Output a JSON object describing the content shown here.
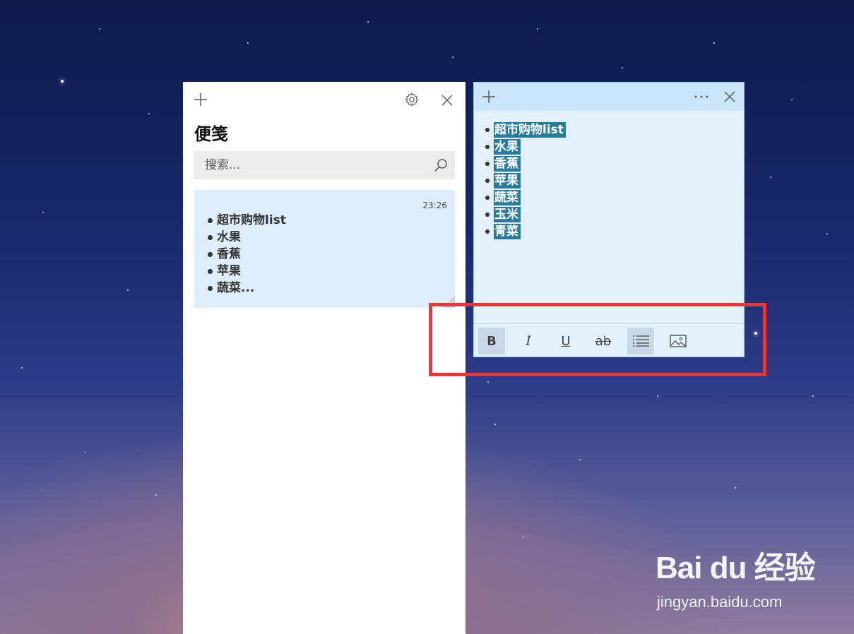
{
  "list_panel": {
    "title": "便笺",
    "search_placeholder": "搜索...",
    "note_card": {
      "time": "23:26",
      "items": [
        "超市购物list",
        "水果",
        "香蕉",
        "苹果",
        "蔬菜..."
      ]
    }
  },
  "note_window": {
    "items": [
      "超市购物list",
      "水果",
      "香蕉",
      "苹果",
      "蔬菜",
      "玉米",
      "青菜"
    ],
    "toolbar": {
      "bold": "B",
      "italic": "I",
      "underline": "U",
      "strikethrough": "ab"
    }
  },
  "watermark": {
    "logo": "Bai du 经验",
    "url": "jingyan.baidu.com"
  },
  "colors": {
    "selection": "#2a7a9a",
    "note_bg": "#e3f1fd",
    "highlight_frame": "#e8363a"
  }
}
